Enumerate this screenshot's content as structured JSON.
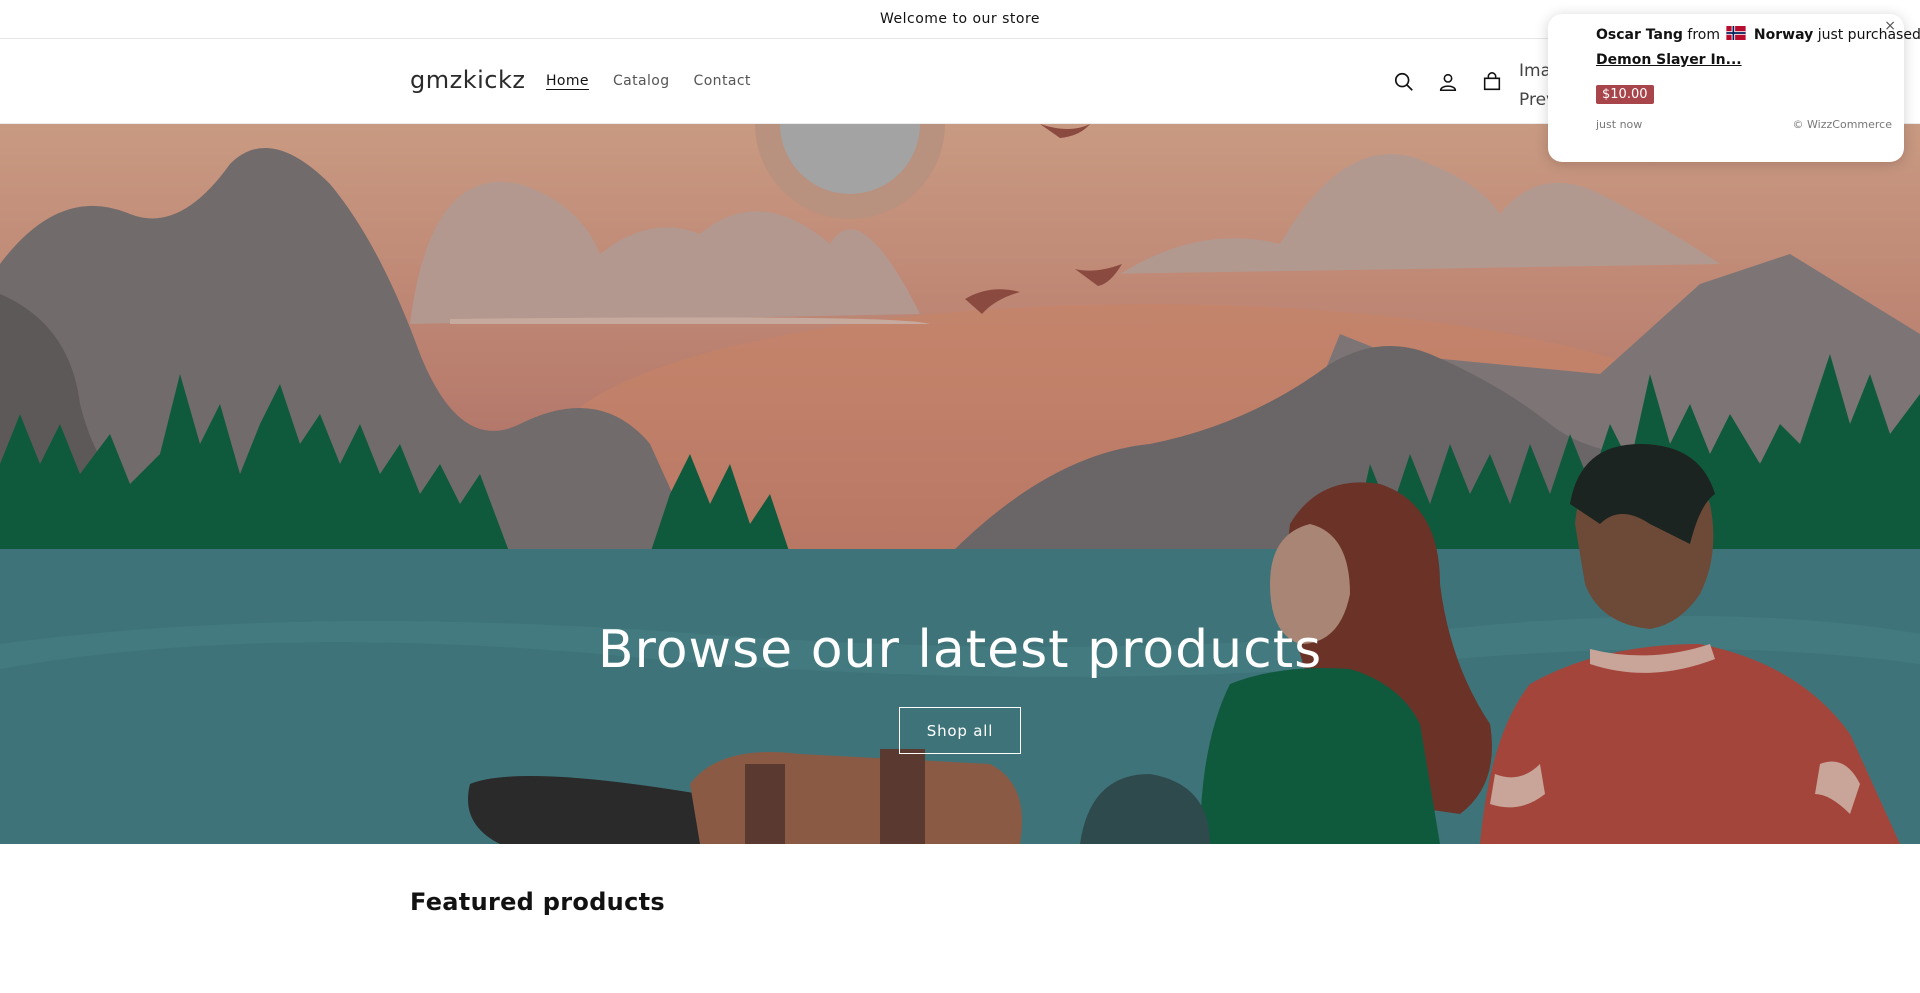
{
  "announcement": {
    "text": "Welcome to our store"
  },
  "header": {
    "logo": "gmzkickz",
    "nav": [
      {
        "label": "Home",
        "active": true
      },
      {
        "label": "Catalog",
        "active": false
      },
      {
        "label": "Contact",
        "active": false
      }
    ],
    "icons": [
      "search-icon",
      "account-icon",
      "cart-icon"
    ],
    "broken_image_alt": "Image Preview"
  },
  "hero": {
    "heading": "Browse our latest products",
    "button_label": "Shop all"
  },
  "featured": {
    "title": "Featured products"
  },
  "popup": {
    "name": "Oscar Tang",
    "from_text": "from",
    "country": "Norway",
    "action_text": "just purchased",
    "product": "Demon Slayer In...",
    "price": "$10.00",
    "time": "just now",
    "brand": "© WizzCommerce",
    "close": "×"
  },
  "colors": {
    "water": "#3e7479",
    "price_badge": "#a8454a",
    "sky": "#c98e7c"
  }
}
